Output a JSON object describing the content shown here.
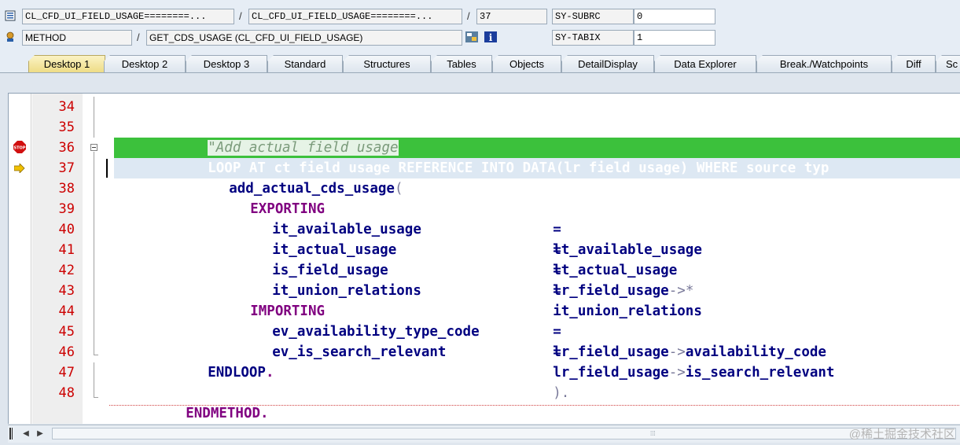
{
  "header": {
    "row1": {
      "program": "CL_CFD_UI_FIELD_USAGE========...",
      "include": "CL_CFD_UI_FIELD_USAGE========...",
      "line": "37",
      "sysvar_name": "SY-SUBRC",
      "sysvar_value": "0"
    },
    "row2": {
      "event_type": "METHOD",
      "event_name": "GET_CDS_USAGE (CL_CFD_UI_FIELD_USAGE)",
      "sysvar_name": "SY-TABIX",
      "sysvar_value": "1"
    },
    "separator": "/"
  },
  "tabs": [
    {
      "label": "Desktop 1",
      "active": true
    },
    {
      "label": "Desktop 2"
    },
    {
      "label": "Desktop 3"
    },
    {
      "label": "Standard"
    },
    {
      "label": "Structures"
    },
    {
      "label": "Tables"
    },
    {
      "label": "Objects"
    },
    {
      "label": "DetailDisplay"
    },
    {
      "label": "Data Explorer"
    },
    {
      "label": "Break./Watchpoints"
    },
    {
      "label": "Diff"
    },
    {
      "label": "Sc"
    }
  ],
  "code": {
    "line_numbers": [
      "34",
      "35",
      "36",
      "37",
      "38",
      "39",
      "40",
      "41",
      "42",
      "43",
      "44",
      "45",
      "46",
      "47",
      "48"
    ],
    "breakpoint_line": "36",
    "current_line": "37",
    "lines": {
      "l35": "\"Add actual field usage",
      "l36_loop": "LOOP AT ct field usage REFERENCE INTO DATA(lr field usage) WHERE source typ",
      "l37_method": "add_actual_cds_usage",
      "l37_paren": "(",
      "l38": "EXPORTING",
      "l39_param": "it_available_usage",
      "l39_value": "lt_available_usage",
      "l40_param": "it_actual_usage",
      "l40_value": "lt_actual_usage",
      "l41_param": "is_field_usage",
      "l41_value": "lr_field_usage",
      "l41_arrow": "->",
      "l41_star": "*",
      "l42_param": "it_union_relations",
      "l42_value": "it_union_relations",
      "l43": "IMPORTING",
      "l44_param": "ev_availability_type_code",
      "l44_value1": "lr_field_usage",
      "l44_arrow": "->",
      "l44_value2": "availability_code",
      "l45_param": "ev_is_search_relevant",
      "l45_value1": "lr_field_usage",
      "l45_arrow": "->",
      "l45_value2": "is_search_relevant",
      "l45_close": ").",
      "l46": "ENDLOOP",
      "l46_dot": ".",
      "l48": "ENDMETHOD",
      "l48_dot": ".",
      "assign": "="
    }
  },
  "watermark": "@稀土掘金技术社区",
  "colors": {
    "breakpoint_highlight": "#3cc13c",
    "current_line_highlight": "#dde8f3",
    "line_number": "#cc0000",
    "keyword": "#800080",
    "identifier": "#000080"
  }
}
